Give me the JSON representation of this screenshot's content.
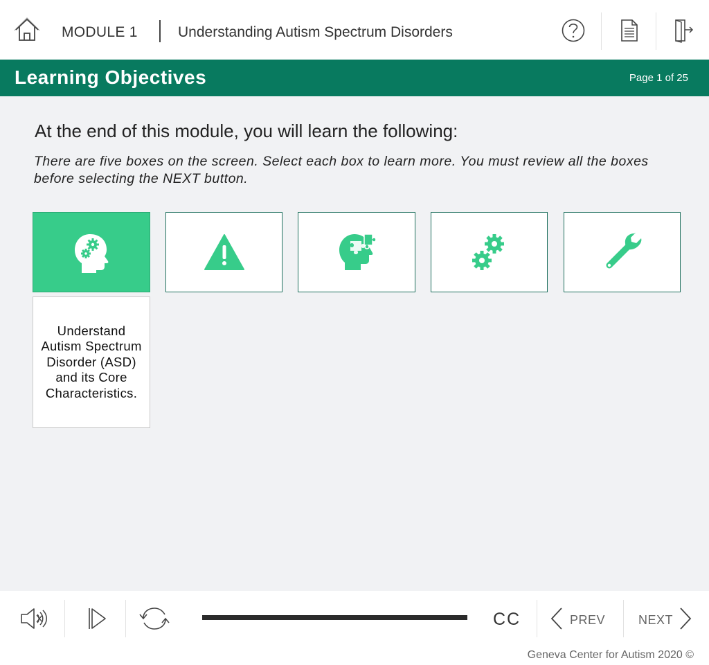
{
  "header": {
    "module_label": "MODULE 1",
    "course_title": "Understanding Autism Spectrum Disorders",
    "icons": [
      "home-icon",
      "help-icon",
      "document-icon",
      "exit-icon"
    ]
  },
  "band": {
    "title": "Learning Objectives",
    "page_indicator": "Page 1 of 25"
  },
  "content": {
    "intro": "At the end of this module, you will learn the following:",
    "instructions": "There are five boxes on the screen. Select each box to learn more. You must review all the boxes before selecting the NEXT button.",
    "boxes": [
      {
        "icon": "head-gears-icon",
        "active": true
      },
      {
        "icon": "warning-icon",
        "active": false
      },
      {
        "icon": "head-puzzle-icon",
        "active": false
      },
      {
        "icon": "gears-icon",
        "active": false
      },
      {
        "icon": "wrench-icon",
        "active": false
      }
    ],
    "popup_text": "Understand Autism Spectrum Disorder (ASD) and its Core Characteristics."
  },
  "player": {
    "cc_label": "CC",
    "prev_label": "PREV",
    "next_label": "NEXT",
    "progress": 1.0,
    "icons": [
      "volume-icon",
      "play-icon",
      "replay-icon",
      "chevron-left-icon",
      "chevron-right-icon"
    ]
  },
  "footer": {
    "copyright": "Geneva Center for Autism 2020 ©"
  },
  "colors": {
    "band_green": "#087a5f",
    "active_box": "#37cc8a",
    "icon_green": "#37cc8a",
    "box_border": "#1d6f5c"
  }
}
